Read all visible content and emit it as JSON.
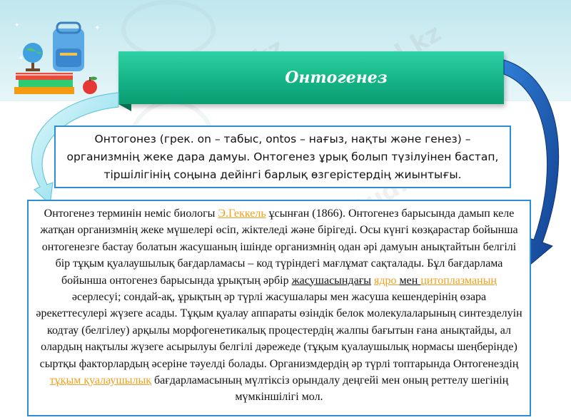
{
  "slide": {
    "title": "Онтогенез",
    "definition": "Онтогонез (грек. on – табыс, ontos – нағыз, нақты және генез) – организмнің жеке дара дамуы. Онтогенез ұрық болып түзілуінен бастап, тіршілігінің соңына дейінгі барлық өзгерістердің жиынтығы.",
    "body": {
      "t1": "Онтогенез терминін неміс биологы ",
      "link_haeckel": "Э.Геккель",
      "t2": " ұсынған (1866). Онтогенез барысында дамып келе жатқан организмнің жеке мүшелері өсіп, жіктеледі және бірігеді. Осы күнгі көзқарастар бойынша онтогенезге бастау болатын жасушаның ішінде организмнің одан әрі дамуын анықтайтын белгілі бір тұқым қуалаушылық бағдарламасы – код түріндегі мағлұмат сақталады. Бұл бағдарлама бойынша онтогенез барысында ұрықтың әрбір ",
      "cell_word": "жасушасындағы",
      "sp1": " ",
      "link_nucleus": "ядро ",
      "and_word": "мен ",
      "link_cytoplasm": "цитоплазманың",
      "t3": " әсерлесуі; сондай-ақ, ұрықтың әр түрлі жасушалары мен жасуша кешендерінің өзара әрекеттесулері жүзеге асады. Тұқым қуалау аппараты өзіндік белок молекулаларының синтезделуін кодтау (белгілеу) арқылы морфогенетикалық процестердің жалпы бағытын ғана анықтайды, ал олардың нақтылы жүзеге асырылуы белгілі дәрежеде (тұқым қуалаушылық нормасы шеңберінде) сыртқы факторлардың әсеріне тәуелді болады. Организмдердің әр түрлі топтарында Онтогенездің ",
      "link_heredity": "тұқым қуалаушылық",
      "t4": " бағдарламасының мүлтіксіз орындалу деңгейі мен оның реттелу шегінің мүмкіншілігі мол."
    }
  },
  "watermark": "Stud.kz",
  "colors": {
    "title_bg": "#14b486",
    "box_border": "#2b8fd6",
    "link": "#f0a020",
    "arrow_left": "#8fe3ef",
    "arrow_right": "#1c5fb8"
  }
}
